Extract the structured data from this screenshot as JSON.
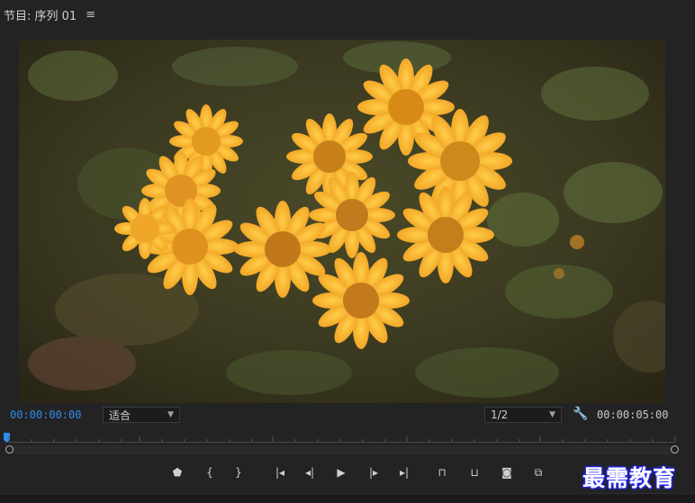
{
  "panel": {
    "title": "节目: 序列 01",
    "menu_glyph": "≡"
  },
  "viewer": {
    "content": "flower-video-frame"
  },
  "controls": {
    "current_timecode": "00:00:00:00",
    "zoom_value": "适合",
    "resolution_value": "1/2",
    "duration_timecode": "00:00:05:00",
    "accent": "#2f8cf0"
  },
  "transport": {
    "buttons": [
      {
        "name": "add-marker-icon",
        "glyph": "⬟"
      },
      {
        "name": "mark-in-icon",
        "glyph": "{"
      },
      {
        "name": "mark-out-icon",
        "glyph": "}"
      },
      {
        "name": "go-to-in-icon",
        "glyph": "|◂"
      },
      {
        "name": "step-back-icon",
        "glyph": "◂|"
      },
      {
        "name": "play-icon",
        "glyph": "▶"
      },
      {
        "name": "step-forward-icon",
        "glyph": "|▸"
      },
      {
        "name": "go-to-out-icon",
        "glyph": "▸|"
      },
      {
        "name": "lift-icon",
        "glyph": "⊓"
      },
      {
        "name": "extract-icon",
        "glyph": "⊔"
      },
      {
        "name": "export-frame-icon",
        "glyph": "◙"
      },
      {
        "name": "comparison-view-icon",
        "glyph": "⧉"
      }
    ]
  },
  "watermark": {
    "text": "最需教育"
  }
}
